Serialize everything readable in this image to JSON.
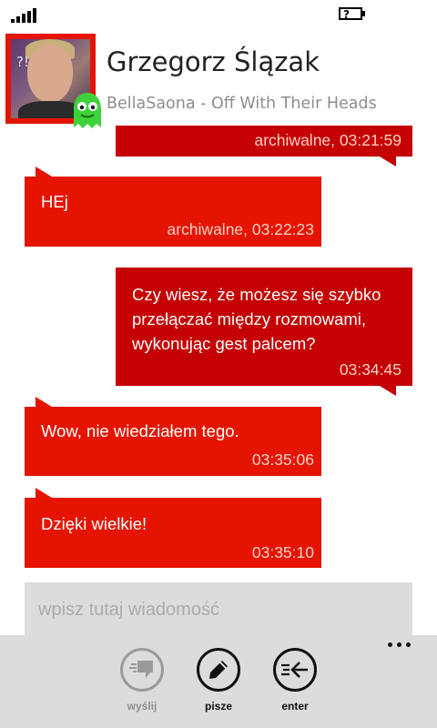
{
  "status_bar": {
    "signal_bars": 5,
    "battery_glyph": "?"
  },
  "contact": {
    "name": "Grzegorz Ślązak",
    "status": "BellaSaona - Off With Their Heads",
    "avatar_text": "?!",
    "presence_icon": "green-ghost-icon"
  },
  "messages": [
    {
      "direction": "out",
      "text": "",
      "time": "archiwalne, 03:21:59"
    },
    {
      "direction": "in",
      "text": "HEj",
      "time": "archiwalne, 03:22:23"
    },
    {
      "direction": "out",
      "text": "Czy wiesz, że możesz się szybko przełączać między rozmowami, wykonując gest palcem?",
      "time": "03:34:45"
    },
    {
      "direction": "in",
      "text": "Wow, nie wiedziałem tego.",
      "time": "03:35:06"
    },
    {
      "direction": "in",
      "text": "Dzięki wielkie!",
      "time": "03:35:10"
    }
  ],
  "composer": {
    "placeholder": "wpisz tutaj wiadomość"
  },
  "app_bar": {
    "buttons": [
      {
        "label": "wyślij",
        "icon": "send-icon",
        "enabled": false
      },
      {
        "label": "pisze",
        "icon": "pencil-icon",
        "enabled": true
      },
      {
        "label": "enter",
        "icon": "enter-icon",
        "enabled": true
      }
    ],
    "more_icon": "ellipsis-icon"
  },
  "colors": {
    "accent": "#e51400",
    "outgoing_bubble": "#c50000",
    "input_bg": "#dedbdc",
    "app_bar_bg": "#dcdcdc"
  }
}
